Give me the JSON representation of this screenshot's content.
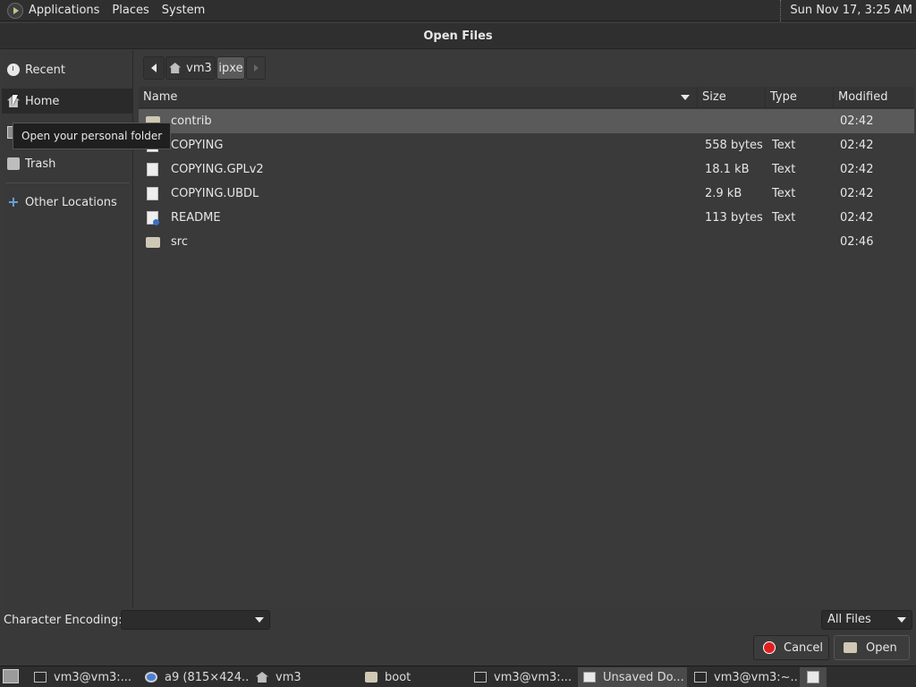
{
  "top_panel": {
    "menus": [
      "Applications",
      "Places",
      "System"
    ],
    "clock": "Sun Nov 17,  3:25 AM"
  },
  "dialog": {
    "title": "Open Files"
  },
  "sidebar": {
    "items": [
      {
        "label": "Recent",
        "icon": "recent-icon"
      },
      {
        "label": "Home",
        "icon": "home-icon"
      },
      {
        "label": "",
        "icon": "desktop-icon"
      },
      {
        "label": "Trash",
        "icon": "trash-icon"
      },
      {
        "label": "Other Locations",
        "icon": "plus-icon"
      }
    ],
    "tooltip": "Open your personal folder"
  },
  "pathbar": {
    "segments": [
      "vm3",
      "ipxe"
    ]
  },
  "filelist": {
    "columns": [
      "Name",
      "Size",
      "Type",
      "Modified"
    ],
    "rows": [
      {
        "name": "contrib",
        "size": "",
        "type": "",
        "modified": "02:42",
        "icon": "folder-icon",
        "selected": true
      },
      {
        "name": "COPYING",
        "size": "558 bytes",
        "type": "Text",
        "modified": "02:42",
        "icon": "document-icon"
      },
      {
        "name": "COPYING.GPLv2",
        "size": "18.1 kB",
        "type": "Text",
        "modified": "02:42",
        "icon": "document-icon"
      },
      {
        "name": "COPYING.UBDL",
        "size": "2.9 kB",
        "type": "Text",
        "modified": "02:42",
        "icon": "document-icon"
      },
      {
        "name": "README",
        "size": "113 bytes",
        "type": "Text",
        "modified": "02:42",
        "icon": "readme-icon"
      },
      {
        "name": "src",
        "size": "",
        "type": "",
        "modified": "02:46",
        "icon": "folder-icon"
      }
    ]
  },
  "bottom": {
    "encoding_label": "Character Encoding:",
    "encoding_value": "",
    "filter_value": "All Files",
    "cancel_label": "Cancel",
    "open_label": "Open"
  },
  "taskbar": {
    "tasks": [
      {
        "label": "vm3@vm3:...",
        "icon": "terminal-icon"
      },
      {
        "label": "a9 (815×424...",
        "icon": "chrome-icon"
      },
      {
        "label": "vm3",
        "icon": "home-folder-icon"
      },
      {
        "label": "boot",
        "icon": "folder-icon"
      },
      {
        "label": "vm3@vm3:...",
        "icon": "terminal-icon"
      },
      {
        "label": "Unsaved Do...",
        "icon": "text-editor-icon",
        "active": true
      },
      {
        "label": "vm3@vm3:~...",
        "icon": "terminal-icon"
      }
    ]
  }
}
